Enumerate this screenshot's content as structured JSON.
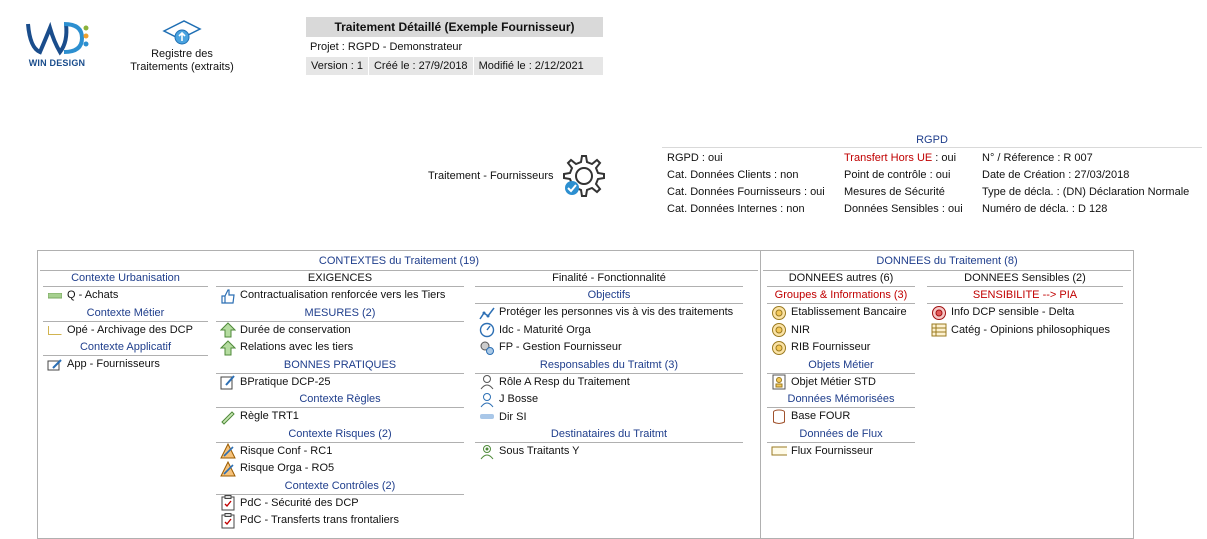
{
  "header": {
    "logo_text": "WIN DESIGN",
    "registre_label": "Registre des Traitements (extraits)",
    "title": "Traitement Détaillé (Exemple Fournisseur)",
    "projet": "Projet : RGPD - Demonstrateur",
    "version": "Version : 1",
    "cree": "Créé le : 27/9/2018",
    "modifie": "Modifié le : 2/12/2021"
  },
  "traitement": {
    "label": "Traitement - Fournisseurs"
  },
  "rgpd": {
    "title": "RGPD",
    "col1": [
      "RGPD : oui",
      "Cat. Données Clients : non",
      "Cat. Données Fournisseurs : oui",
      "Cat. Données Internes : non"
    ],
    "col2_first_label": "Transfert Hors UE",
    "col2_first_value": " : oui",
    "col2": [
      "Point de contrôle : oui",
      "Mesures de Sécurité",
      "Données Sensibles : oui"
    ],
    "col3": [
      "N° / Réference : R 007",
      "Date de Création : 27/03/2018",
      "Type de décla. : (DN) Déclaration Normale",
      "Numéro de décla. : D 128"
    ]
  },
  "contextes": {
    "title": "CONTEXTES du Traitement (19)",
    "col1": {
      "h1": "Contexte Urbanisation",
      "i1": "Q - Achats",
      "h2": "Contexte Métier",
      "i2": "Opé - Archivage des DCP",
      "h3": "Contexte Applicatif",
      "i3": "App - Fournisseurs"
    },
    "col2": {
      "h1": "EXIGENCES",
      "i1": "Contractualisation renforcée vers les Tiers",
      "h2": "MESURES (2)",
      "i2a": "Durée de conservation",
      "i2b": "Relations avec les tiers",
      "h3": "BONNES PRATIQUES",
      "i3": "BPratique DCP-25",
      "h4": "Contexte Règles",
      "i4": "Règle TRT1",
      "h5": "Contexte Risques (2)",
      "i5a": "Risque Conf - RC1",
      "i5b": "Risque Orga - RO5",
      "h6": "Contexte Contrôles (2)",
      "i6a": "PdC - Sécurité des DCP",
      "i6b": "PdC - Transferts trans frontaliers"
    },
    "col3": {
      "h0": "Finalité - Fonctionnalité",
      "h1": "Objectifs",
      "i1a": "Protéger les personnes vis à vis des traitements",
      "i1b": "Idc - Maturité Orga",
      "i1c": "FP - Gestion Fournisseur",
      "h2": "Responsables du Traitmt (3)",
      "i2a": "Rôle A Resp du Traitement",
      "i2b": "J Bosse",
      "i2c": "Dir SI",
      "h3": "Destinataires du Traitmt",
      "i3": "Sous Traitants Y"
    }
  },
  "donnees": {
    "title": "DONNEES du Traitement (8)",
    "col1": {
      "h0": "DONNEES autres (6)",
      "h1": "Groupes & Informations (3)",
      "i1a": "Etablissement Bancaire",
      "i1b": "NIR",
      "i1c": "RIB Fournisseur",
      "h2": "Objets Métier",
      "i2": "Objet Métier STD",
      "h3": "Données Mémorisées",
      "i3": "Base FOUR",
      "h4": "Données de Flux",
      "i4": "Flux Fournisseur"
    },
    "col2": {
      "h0": "DONNEES Sensibles (2)",
      "h1": "SENSIBILITE --> PIA",
      "i1a": "Info DCP sensible - Delta",
      "i1b": "Catég - Opinions philosophiques"
    }
  },
  "colors": {
    "accent_blue": "#1f3e8c",
    "alert_red": "#c00000",
    "header_gray": "#d9d9d9"
  }
}
